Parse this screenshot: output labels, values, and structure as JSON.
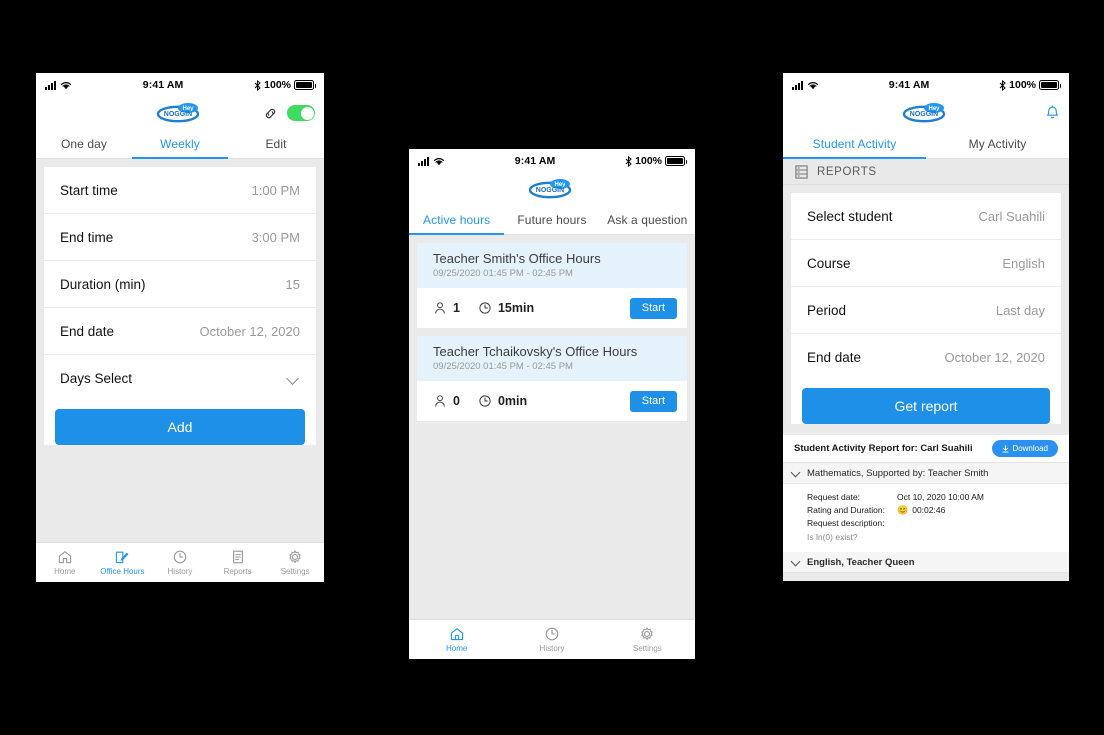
{
  "brand": {
    "logo_text_top": "Hey",
    "logo_text_main": "NOGGIN",
    "accent": "#1e90e8",
    "toggle_on_color": "#3ddc60"
  },
  "status_bar": {
    "time": "9:41 AM",
    "battery": "100%"
  },
  "phone_one": {
    "header": {
      "link_icon": "link-icon",
      "toggle_state": "on"
    },
    "tabs": [
      {
        "label": "One day",
        "active": false
      },
      {
        "label": "Weekly",
        "active": true
      },
      {
        "label": "Edit",
        "active": false
      }
    ],
    "form": {
      "rows": [
        {
          "label": "Start time",
          "value": "1:00 PM"
        },
        {
          "label": "End time",
          "value": "3:00 PM"
        },
        {
          "label": "Duration (min)",
          "value": "15"
        },
        {
          "label": "End date",
          "value": "October 12, 2020"
        }
      ],
      "days_select_label": "Days Select",
      "submit_label": "Add"
    },
    "tabbar": [
      {
        "label": "Home",
        "icon": "home-icon",
        "active": false
      },
      {
        "label": "Office Hours",
        "icon": "edit-icon",
        "active": true
      },
      {
        "label": "History",
        "icon": "clock-icon",
        "active": false
      },
      {
        "label": "Reports",
        "icon": "document-icon",
        "active": false
      },
      {
        "label": "Settings",
        "icon": "gear-icon",
        "active": false
      }
    ]
  },
  "phone_two": {
    "tabs": [
      {
        "label": "Active hours",
        "active": true
      },
      {
        "label": "Future hours",
        "active": false
      },
      {
        "label": "Ask a question",
        "active": false
      }
    ],
    "office_hours": [
      {
        "title": "Teacher Smith's Office Hours",
        "subtitle": "09/25/2020 01:45 PM - 02:45 PM",
        "attendees": "1",
        "duration": "15min",
        "action_label": "Start"
      },
      {
        "title": "Teacher Tchaikovsky's Office Hours",
        "subtitle": "09/25/2020 01:45 PM - 02:45 PM",
        "attendees": "0",
        "duration": "0min",
        "action_label": "Start"
      }
    ],
    "tabbar": [
      {
        "label": "Home",
        "icon": "home-icon",
        "active": true
      },
      {
        "label": "History",
        "icon": "clock-icon",
        "active": false
      },
      {
        "label": "Settings",
        "icon": "gear-icon",
        "active": false
      }
    ]
  },
  "phone_three": {
    "header": {
      "bell_icon": "bell-icon"
    },
    "tabs": [
      {
        "label": "Student Activity",
        "active": true
      },
      {
        "label": "My Activity",
        "active": false
      }
    ],
    "section_title": "REPORTS",
    "form": {
      "rows": [
        {
          "label": "Select student",
          "value": "Carl Suahili"
        },
        {
          "label": "Course",
          "value": "English"
        },
        {
          "label": "Period",
          "value": "Last day"
        },
        {
          "label": "End date",
          "value": "October 12, 2020"
        }
      ],
      "submit_label": "Get report"
    },
    "report": {
      "header": "Student Activity Report for: Carl Suahili",
      "download_label": "Download",
      "groups": [
        {
          "title": "Mathematics, Supported by: Teacher Smith",
          "expanded": true,
          "fields": [
            {
              "key": "Request date:",
              "value": "Oct 10, 2020 10:00 AM"
            },
            {
              "key": "Rating and Duration:",
              "value": "00:02:46",
              "emoji": "😊"
            },
            {
              "key": "Request description:",
              "value": ""
            }
          ],
          "note": "Is ln(0) exist?"
        },
        {
          "title": "English, Teacher Queen",
          "expanded": false
        }
      ]
    }
  }
}
